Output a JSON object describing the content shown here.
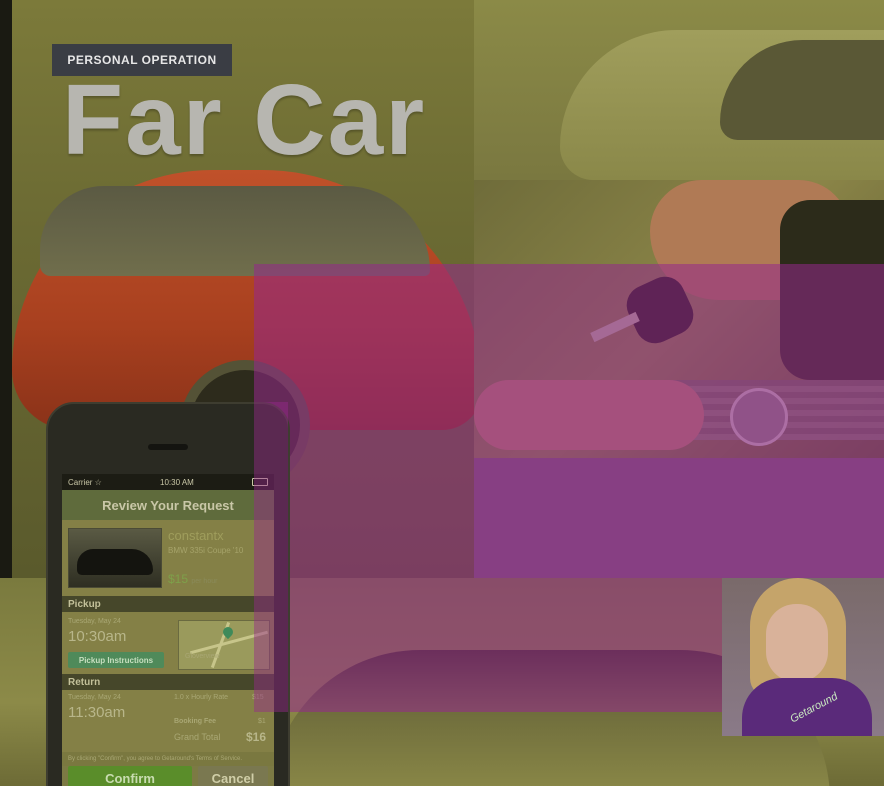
{
  "header": {
    "tag": "PERSONAL OPERATION",
    "title": "Far Car"
  },
  "colors": {
    "tint_olive": "#7c7a3a",
    "tint_magenta": "#96288c",
    "car_orange": "#c0512a",
    "title_gray": "#b7b6b0",
    "confirm_green": "#5a8d2a",
    "pickup_button": "#4f8a5a"
  },
  "phone": {
    "status": {
      "carrier": "Carrier ☆",
      "time": "10:30 AM",
      "battery_icon": "battery-icon"
    },
    "screen_title": "Review Your Request",
    "listing": {
      "owner": "constantx",
      "model": "BMW 335i Coupe '10",
      "price": "$15",
      "price_unit": "per hour"
    },
    "pickup": {
      "section": "Pickup",
      "date": "Tuesday, May 24",
      "time": "10:30am",
      "button": "Pickup Instructions",
      "map_label": "Gloverview"
    },
    "return": {
      "section": "Return",
      "date": "Tuesday, May 24",
      "time": "11:30am",
      "rate_label": "1.0 x Hourly Rate",
      "rate_value": "$15",
      "fee_label": "Booking Fee",
      "fee_value": "$1",
      "total_label": "Grand Total",
      "total_value": "$16"
    },
    "fine_print": "By clicking \"Confirm\", you agree to Getaround's Terms of Service.",
    "confirm": "Confirm",
    "cancel": "Cancel"
  },
  "photo_badge": {
    "brand": "Getaround"
  }
}
